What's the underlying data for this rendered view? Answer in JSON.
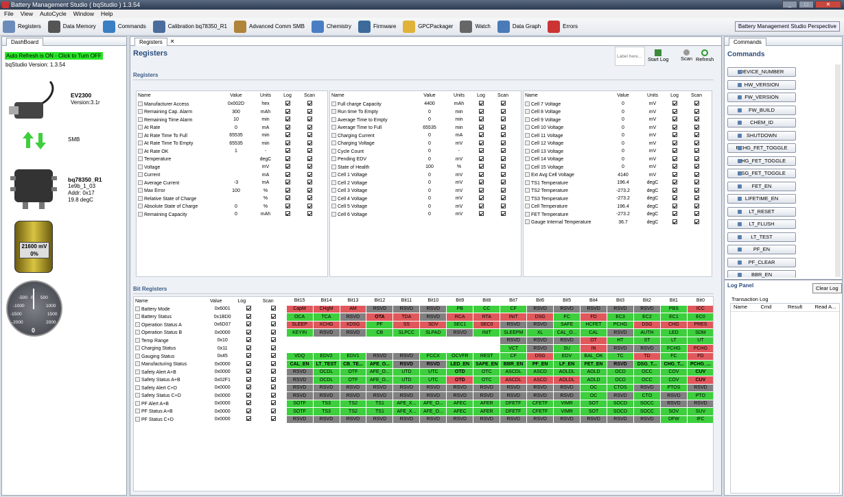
{
  "window": {
    "title": "Battery Management Studio ( bqStudio ) 1.3.54"
  },
  "menu": [
    "File",
    "View",
    "AutoCycle",
    "Window",
    "Help"
  ],
  "toolbar": [
    "Registers",
    "Data Memory",
    "Commands",
    "Calibration bq78350_R1",
    "Advanced Comm SMB",
    "Chemistry",
    "Firmware",
    "GPCPackager",
    "Watch",
    "Data Graph",
    "Errors"
  ],
  "perspective": "Battery Management Studio Perspective",
  "dashboard": {
    "tab": "DashBoard",
    "auto_refresh": "Auto Refresh is ON - Click to Turn OFF",
    "version": "bqStudio Version:  1.3.54",
    "ev_name": "EV2300",
    "ev_version": "Version:3.1r",
    "smb": "SMB",
    "dev_name": "bq78350_R1",
    "dev_l1": "1e9b_1_03",
    "dev_l2": "Addr: 0x17",
    "dev_l3": "19.8 degC",
    "battery_mv": "21600 mV",
    "battery_pct": "0%",
    "gauge_ticks": [
      "-500",
      "0",
      "500",
      "-1000",
      "1000",
      "-1500",
      "1500",
      "-2000",
      "2000"
    ],
    "gauge_value": "0"
  },
  "registers": {
    "tab": "Registers",
    "title": "Registers",
    "section": "Registers",
    "label_placeholder": "Label here...",
    "start_log": "Start Log",
    "scan": "Scan",
    "refresh": "Refresh",
    "headers": [
      "Name",
      "Value",
      "Units",
      "Log",
      "Scan"
    ],
    "col1": [
      [
        "Manufacturer Access",
        "0x002D",
        "hex"
      ],
      [
        "Remaining Cap. Alarm",
        "300",
        "mAh"
      ],
      [
        "Remaining Time Alarm",
        "10",
        "min"
      ],
      [
        "At Rate",
        "0",
        "mA"
      ],
      [
        "At Rate Time To Full",
        "65535",
        "min"
      ],
      [
        "At Rate Time To Empty",
        "65535",
        "min"
      ],
      [
        "At Rate OK",
        "1",
        "-"
      ],
      [
        "Temperature",
        "",
        "degC"
      ],
      [
        "Voltage",
        "",
        "mV"
      ],
      [
        "Current",
        "",
        "mA"
      ],
      [
        "Average Current",
        "-3",
        "mA"
      ],
      [
        "Max Error",
        "100",
        "%"
      ],
      [
        "Relative State of Charge",
        "",
        "%"
      ],
      [
        "Absolute State of Charge",
        "0",
        "%"
      ],
      [
        "Remaining Capacity",
        "0",
        "mAh"
      ]
    ],
    "col2": [
      [
        "Full charge Capacity",
        "4400",
        "mAh"
      ],
      [
        "Run time To Empty",
        "0",
        "min"
      ],
      [
        "Average Time to Empty",
        "0",
        "min"
      ],
      [
        "Average Time to Full",
        "65535",
        "min"
      ],
      [
        "Charging Current",
        "0",
        "mA"
      ],
      [
        "Charging Voltage",
        "0",
        "mV"
      ],
      [
        "Cycle Count",
        "0",
        "-"
      ],
      [
        "Pending EDV",
        "0",
        "mV"
      ],
      [
        "State of Health",
        "100",
        "%"
      ],
      [
        "Cell 1 Voltage",
        "0",
        "mV"
      ],
      [
        "Cell 2 Voltage",
        "0",
        "mV"
      ],
      [
        "Cell 3 Voltage",
        "0",
        "mV"
      ],
      [
        "Cell 4 Voltage",
        "0",
        "mV"
      ],
      [
        "Cell 5 Voltage",
        "0",
        "mV"
      ],
      [
        "Cell 6 Voltage",
        "0",
        "mV"
      ]
    ],
    "col3": [
      [
        "Cell 7 Voltage",
        "0",
        "mV"
      ],
      [
        "Cell 8 Voltage",
        "0",
        "mV"
      ],
      [
        "Cell 9 Voltage",
        "0",
        "mV"
      ],
      [
        "Cell 10 Voltage",
        "0",
        "mV"
      ],
      [
        "Cell 11 Voltage",
        "0",
        "mV"
      ],
      [
        "Cell 12 Voltage",
        "0",
        "mV"
      ],
      [
        "Cell 13 Voltage",
        "0",
        "mV"
      ],
      [
        "Cell 14 Voltage",
        "0",
        "mV"
      ],
      [
        "Cell 15 Voltage",
        "0",
        "mV"
      ],
      [
        "Ext Avg Cell Voltage",
        "4140",
        "mV"
      ],
      [
        "TS1 Temperature",
        "196.4",
        "degC"
      ],
      [
        "TS2 Temperature",
        "-273.2",
        "degC"
      ],
      [
        "TS3 Temperature",
        "-273.2",
        "degC"
      ],
      [
        "Cell Temperature",
        "196.4",
        "degC"
      ],
      [
        "FET Temperature",
        "-273.2",
        "degC"
      ],
      [
        "Gauge Internal Temperature",
        "36.7",
        "degC"
      ]
    ]
  },
  "bits": {
    "section": "Bit Registers",
    "headers": [
      "Name",
      "Value",
      "Log",
      "Scan",
      "Bit15",
      "Bit14",
      "Bit13",
      "Bit12",
      "Bit11",
      "Bit10",
      "Bit9",
      "Bit8",
      "Bit7",
      "Bit6",
      "Bit5",
      "Bit4",
      "Bit3",
      "Bit2",
      "Bit1",
      "Bit0"
    ],
    "rows": [
      [
        "Battery Mode",
        "0x6001",
        "CapM:r CHgM:r AM:r RSVD:y RSVD:y RSVD:y PB:g CC:g CF:g RSVD:y RSVD:y RSVD:y RSVD:y RSVD:y PBS:g ICC:r"
      ],
      [
        "Battery Status",
        "0x1BD0",
        "OCA:g TCA:g RSVD:y OTA:r TDA:r RSVD:y RCA:r RTA:r INIT:r DSG:r FC:g FD:r EC3:g EC2:g EC1:g EC0:g"
      ],
      [
        "Operation Status A",
        "0x6D07",
        "SLEEP:r XCHG:r XDSG:r PF:g SS:r SDV:r SEC1:g SEC0:r RSVD:y RSVD:y SAFE:g HCFET:g PCHG:g DSG:r CHG:r PRES:r"
      ],
      [
        "Operation Status B",
        "0x0000",
        "KEYIN:g RSVD:y RSVD:y CB:g SLPCC:g SLPAD:g RSVD:y INIT:g SLEEPM:g XL:g CAL_O...:g CAL:g RSVD:y AUTH:g LED:g SDM:g"
      ],
      [
        "Temp Range",
        "0x10",
        "RSVD:y RSVD:y RSVD:y OT:r HT:g ST:g LT:g UT:g"
      ],
      [
        "Charging Status",
        "0x11",
        "VCT:g RSVD:y SU:g IN:r RSVD:y RSVD:y FCHG:g PCHG:r"
      ],
      [
        "Gauging Status",
        "0x45",
        "VDQ:g EDV2:g EDV1:g RSVD:y RSVD:y FCCX:g OCVFR:g REST:g CF:g DSG:r EDV:g BAL_OK:g TC:g TD:r FC:g FD:r"
      ],
      [
        "Manufacturing Status",
        "0x0000",
        "CAL_EN:g LT_TEST:g CB_TE...:g AFE_O...:g RSVD:y RSVD:y LED_EN:g SAFE_EN:g BBR_EN:g PF_EN:g LF_EN:g FET_EN:g RSVD:y DSG_T...:g CHG_T...:g PCHG_...:g"
      ],
      [
        "Safety Alert A+B",
        "0x0000",
        "RSVD:y OCDL:g OTF:g AFE_O...:g UTD:g UTC:g OTD:g OTC:g ASCDL:g ASCD:g AOLDL:g AOLD:g OCD:g OCC:g COV:g CUV:g"
      ],
      [
        "Safety Status A+B",
        "0x02F1",
        "RSVD:y OCDL:g OTF:g AFE_O...:g UTD:g UTC:g OTD:r OTC:g ASCDL:r ASCD:r AOLDL:r AOLD:g OCD:g OCC:g COV:g CUV:r"
      ],
      [
        "Safety Alert C+D",
        "0x0000",
        "RSVD:y RSVD:y RSVD:y RSVD:y RSVD:y RSVD:y RSVD:y RSVD:y RSVD:y RSVD:y RSVD:y OC:g CTOS:g RSVD:y PTOS:g RSVD:y"
      ],
      [
        "Safety Status C+D",
        "0x0000",
        "RSVD:y RSVD:y RSVD:y RSVD:y RSVD:y RSVD:y RSVD:y RSVD:y RSVD:y RSVD:y RSVD:y OC:g RSVD:y CTO:g RSVD:y PTO:g"
      ],
      [
        "PF Alert A+B",
        "0x0000",
        "SOTF:g TS3:g TS2:g TS1:g AFE_X...:g AFE_O...:g AFEC:g AFER:g DFETF:g CFETF:g VIMR:g SOT:g SOCD:g SOCC:g RSVD:y RSVD:y"
      ],
      [
        "PF Status A+B",
        "0x0000",
        "SOTF:g TS3:g TS2:g TS1:g AFE_X...:g AFE_O...:g AFEC:g AFER:g DFETF:g CFETF:g VIMR:g SOT:g SOCD:g SOCC:g SOV:g SUV:g"
      ],
      [
        "PF Status C+D",
        "0x0000",
        "RSVD:y RSVD:y RSVD:y RSVD:y RSVD:y RSVD:y RSVD:y RSVD:y RSVD:y RSVD:y RSVD:y RSVD:y RSVD:y RSVD:y DFW:g IFC:g"
      ]
    ]
  },
  "commands": {
    "tab": "Commands",
    "title": "Commands",
    "buttons": [
      "DEVICE_NUMBER",
      "HW_VERSION",
      "FW_VERSION",
      "FW_BUILD",
      "CHEM_ID",
      "SHUTDOWN",
      "PCHG_FET_TOGGLE",
      "CHG_FET_TOGGLE",
      "DSG_FET_TOGGLE",
      "FET_EN",
      "LIFETIME_EN",
      "LT_RESET",
      "LT_FLUSH",
      "LT_TEST",
      "PF_EN",
      "PF_CLEAR",
      "BBR_EN"
    ]
  },
  "log": {
    "title": "Log Panel",
    "clear": "Clear Log",
    "tx": "Transaction Log",
    "cols": [
      "Name",
      "Cmd",
      "Result",
      "Read A..."
    ]
  },
  "colors": {
    "green": "#3dcf3d",
    "red": "#e0585c",
    "grey": "#808080",
    "autoref": "#29e629"
  }
}
